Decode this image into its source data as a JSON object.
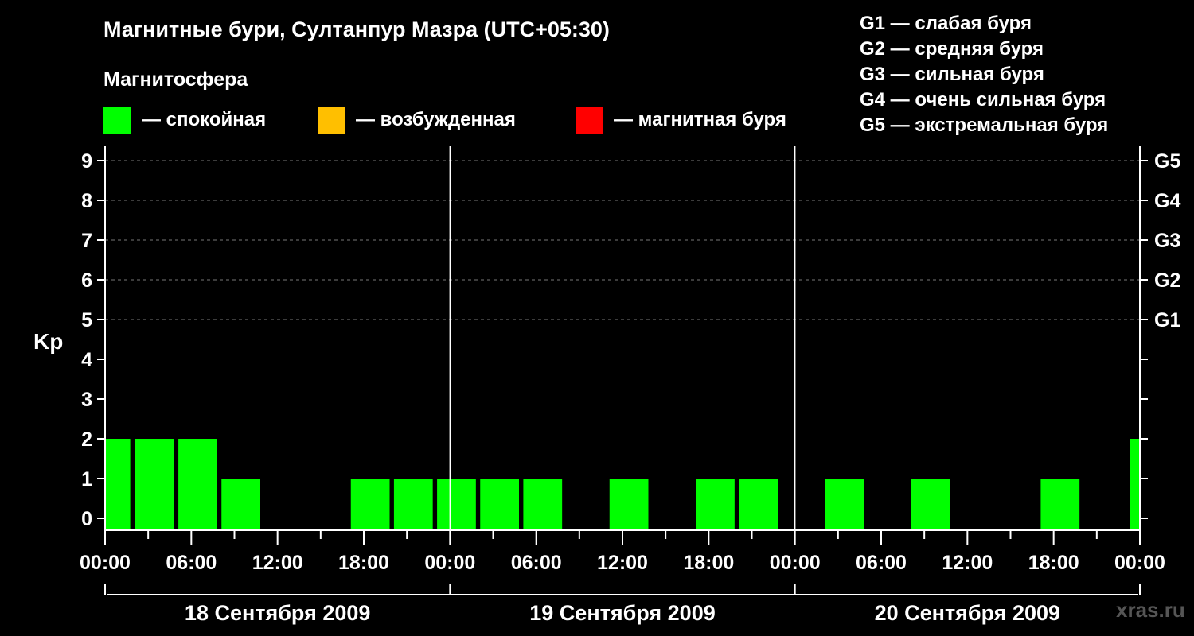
{
  "header": {
    "title": "Магнитные бури, Султанпур Мазра (UTC+05:30)",
    "subtitle": "Магнитосфера"
  },
  "legend": [
    {
      "label": "— спокойная",
      "color": "#00ff00"
    },
    {
      "label": "— возбужденная",
      "color": "#ffbf00"
    },
    {
      "label": "— магнитная буря",
      "color": "#ff0000"
    }
  ],
  "g_legend": [
    "G1 — слабая буря",
    "G2 — средняя буря",
    "G3 — сильная буря",
    "G4 — очень сильная буря",
    "G5 — экстремальная буря"
  ],
  "watermark": "xras.ru",
  "chart_data": {
    "type": "bar",
    "ylabel": "Kp",
    "ylim": [
      0,
      9
    ],
    "yticks": [
      0,
      1,
      2,
      3,
      4,
      5,
      6,
      7,
      8,
      9
    ],
    "right_ticks": [
      {
        "value": 5,
        "label": "G1"
      },
      {
        "value": 6,
        "label": "G2"
      },
      {
        "value": 7,
        "label": "G3"
      },
      {
        "value": 8,
        "label": "G4"
      },
      {
        "value": 9,
        "label": "G5"
      }
    ],
    "xlim_hours": [
      0,
      72
    ],
    "xtick_labels": [
      "00:00",
      "06:00",
      "12:00",
      "18:00",
      "00:00",
      "06:00",
      "12:00",
      "18:00",
      "00:00",
      "06:00",
      "12:00",
      "18:00",
      "00:00"
    ],
    "days": [
      "18 Сентября 2009",
      "19 Сентября 2009",
      "20 Сентября 2009"
    ],
    "grid": "dashed horizontal at Kp 5–9",
    "bar_color": "#00ff00",
    "bars": [
      {
        "start": 0,
        "end": 1.75,
        "kp": 2
      },
      {
        "start": 2.1,
        "end": 4.8,
        "kp": 2
      },
      {
        "start": 5.1,
        "end": 7.8,
        "kp": 2
      },
      {
        "start": 8.1,
        "end": 10.8,
        "kp": 1
      },
      {
        "start": 17.1,
        "end": 19.8,
        "kp": 1
      },
      {
        "start": 20.1,
        "end": 22.8,
        "kp": 1
      },
      {
        "start": 23.1,
        "end": 25.8,
        "kp": 1
      },
      {
        "start": 26.1,
        "end": 28.8,
        "kp": 1
      },
      {
        "start": 29.1,
        "end": 31.8,
        "kp": 1
      },
      {
        "start": 35.1,
        "end": 37.8,
        "kp": 1
      },
      {
        "start": 41.1,
        "end": 43.8,
        "kp": 1
      },
      {
        "start": 44.1,
        "end": 46.8,
        "kp": 1
      },
      {
        "start": 50.1,
        "end": 52.8,
        "kp": 1
      },
      {
        "start": 56.1,
        "end": 58.8,
        "kp": 1
      },
      {
        "start": 65.1,
        "end": 67.8,
        "kp": 1
      },
      {
        "start": 71.3,
        "end": 72,
        "kp": 2
      }
    ]
  }
}
